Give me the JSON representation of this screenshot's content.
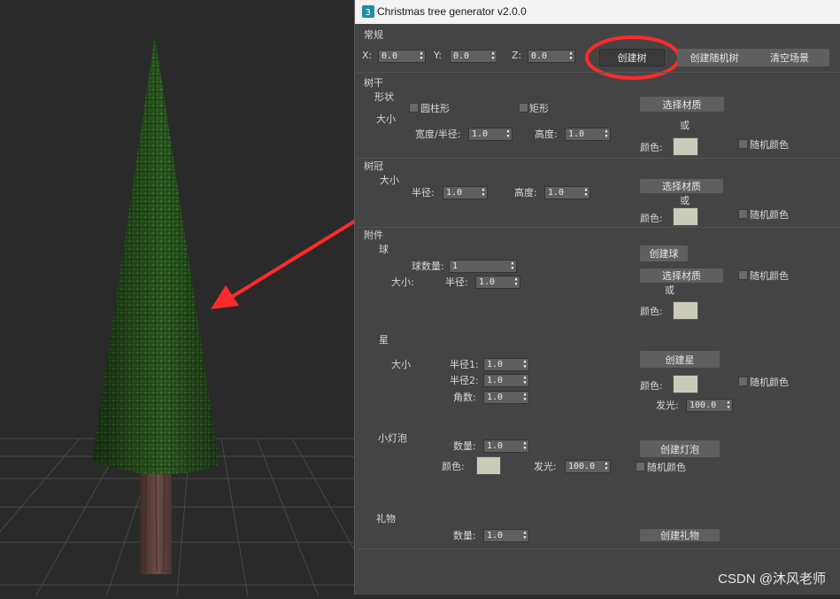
{
  "window": {
    "title": "Christmas tree generator v2.0.0",
    "app_icon": "3dsmax-icon"
  },
  "general": {
    "section_title": "常规",
    "x": {
      "label": "X:",
      "value": "0.0"
    },
    "y": {
      "label": "Y:",
      "value": "0.0"
    },
    "z": {
      "label": "Z:",
      "value": "0.0"
    },
    "create_tree": "创建树",
    "create_random_tree": "创建随机树",
    "clear_scene": "清空场景"
  },
  "trunk": {
    "section_title": "树干",
    "shape_label": "形状",
    "size_label": "大小",
    "cylinder_label": "圆柱形",
    "rectangle_label": "矩形",
    "width_radius": {
      "label": "宽度/半径:",
      "value": "1.0"
    },
    "height": {
      "label": "高度:",
      "value": "1.0"
    },
    "select_material": "选择材质",
    "or": "或",
    "color_label": "颜色:",
    "random_color": "随机颜色"
  },
  "crown": {
    "section_title": "树冠",
    "size_label": "大小",
    "radius": {
      "label": "半径:",
      "value": "1.0"
    },
    "height": {
      "label": "高度:",
      "value": "1.0"
    },
    "select_material": "选择材质",
    "or": "或",
    "color_label": "颜色:",
    "random_color": "随机颜色"
  },
  "attachments": {
    "section_title": "附件",
    "ball": {
      "label": "球",
      "count": {
        "label": "球数量:",
        "value": "1"
      },
      "size_label": "大小:",
      "radius": {
        "label": "半径:",
        "value": "1.0"
      },
      "create": "创建球",
      "select_material": "选择材质",
      "or": "或",
      "color_label": "颜色:",
      "random_color": "随机颜色"
    },
    "star": {
      "label": "星",
      "size_label": "大小",
      "radius1": {
        "label": "半径1:",
        "value": "1.0"
      },
      "radius2": {
        "label": "半径2:",
        "value": "1.0"
      },
      "angles": {
        "label": "角数:",
        "value": "1.0"
      },
      "create": "创建星",
      "color_label": "颜色:",
      "random_color": "随机颜色",
      "glow": {
        "label": "发光:",
        "value": "100.0"
      }
    },
    "bulb": {
      "label": "小灯泡",
      "count": {
        "label": "数量:",
        "value": "1.0"
      },
      "color_label": "颜色:",
      "glow": {
        "label": "发光:",
        "value": "100.0"
      },
      "create": "创建灯泡",
      "random_color": "随机颜色"
    },
    "gift": {
      "label": "礼物",
      "count": {
        "label": "数量:",
        "value": "1.0"
      },
      "create": "创建礼物"
    }
  },
  "colors": {
    "swatch": "#cbcbb9",
    "highlight": "#ff2a2a",
    "crown": "#2e5a22",
    "trunk": "#6e4e48"
  },
  "watermark": "CSDN @沐风老师"
}
